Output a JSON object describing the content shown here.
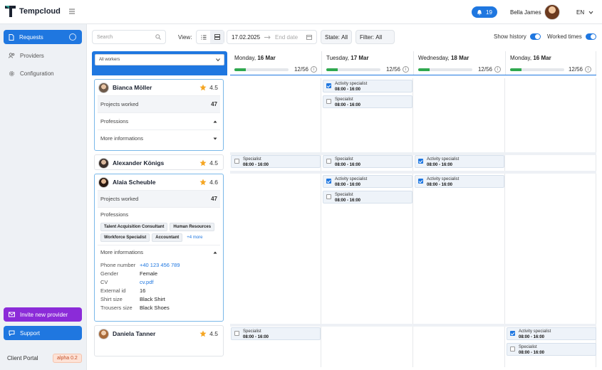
{
  "app": {
    "name": "Tempcloud"
  },
  "topbar": {
    "notifications": "19",
    "user_name": "Bella James",
    "language": "EN"
  },
  "sidebar": {
    "items": [
      {
        "label": "Requests",
        "icon": "document-icon",
        "active": true
      },
      {
        "label": "Providers",
        "icon": "users-icon"
      },
      {
        "label": "Configuration",
        "icon": "gear-icon"
      }
    ],
    "invite_label": "Invite new provider",
    "support_label": "Support",
    "portal_label": "Client Portal",
    "version_label": "alpha 0.2"
  },
  "toolbar": {
    "search_placeholder": "Search",
    "view_label": "View:",
    "start_date": "17.02.2025",
    "end_date_placeholder": "End date",
    "state_label": "State:",
    "state_value": "All",
    "filter_label": "Filter:",
    "filter_value": "All",
    "show_history_label": "Show history",
    "worked_times_label": "Worked times"
  },
  "workers_filter": "All workers",
  "days": [
    {
      "weekday": "Monday,",
      "date": "16 Mar",
      "count": "12/56",
      "progress": 0.21
    },
    {
      "weekday": "Tuesday,",
      "date": "17 Mar",
      "count": "12/56",
      "progress": 0.21
    },
    {
      "weekday": "Wednesday,",
      "date": "18 Mar",
      "count": "12/56",
      "progress": 0.21
    },
    {
      "weekday": "Monday,",
      "date": "16 Mar",
      "count": "12/56",
      "progress": 0.21
    }
  ],
  "workers": [
    {
      "name": "Bianca Möller",
      "rating": "4.5",
      "projects_label": "Projects worked",
      "projects": "47",
      "professions_label": "Professions",
      "more_label": "More informations"
    },
    {
      "name": "Alexander Königs",
      "rating": "4.5"
    },
    {
      "name": "Alaia Scheuble",
      "rating": "4.6",
      "projects_label": "Projects worked",
      "projects": "47",
      "professions_label": "Professions",
      "tags": [
        "Talent Acquisition Consultant",
        "Human Resources",
        "Workforce Specialist",
        "Accountant"
      ],
      "more_tags": "+4 more",
      "more_label": "More informations",
      "info": [
        {
          "k": "Phone number",
          "v": "+40 123 456 789"
        },
        {
          "k": "Gender",
          "v": "Female"
        },
        {
          "k": "CV",
          "v": "cv.pdf"
        },
        {
          "k": "External id",
          "v": "16"
        },
        {
          "k": "Shirt size",
          "v": "Black Shirt"
        },
        {
          "k": "Trousers size",
          "v": "Black Shoes"
        }
      ]
    },
    {
      "name": "Daniela Tanner",
      "rating": "4.5"
    }
  ],
  "shifts": {
    "activity_specialist": "Activity specialist",
    "specialist": "Specialist",
    "time": "08:00 - 16:00"
  },
  "colors": {
    "accent": "#1f77e0",
    "invite": "#8b2bd8",
    "progress": "#2fa84f",
    "star": "#f5a623"
  }
}
